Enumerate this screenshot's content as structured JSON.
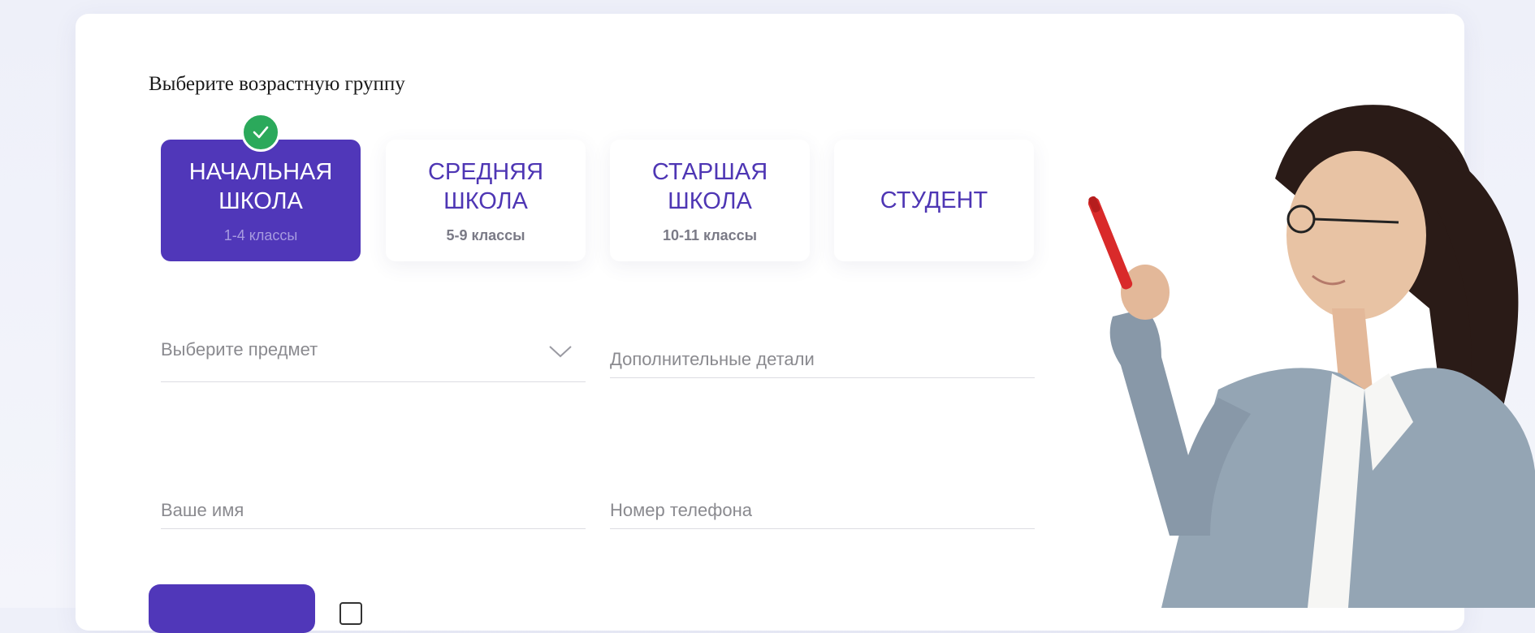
{
  "form": {
    "heading": "Выберите возрастную группу",
    "age_groups": [
      {
        "title": "НАЧАЛЬНАЯ ШКОЛА",
        "subtitle": "1-4 классы",
        "selected": true
      },
      {
        "title": "СРЕДНЯЯ ШКОЛА",
        "subtitle": "5-9 классы",
        "selected": false
      },
      {
        "title": "СТАРШАЯ ШКОЛА",
        "subtitle": "10-11 классы",
        "selected": false
      },
      {
        "title": "СТУДЕНТ",
        "subtitle": "",
        "selected": false
      }
    ],
    "subject_select": {
      "placeholder": "Выберите предмет",
      "icon": "chevron-down-icon"
    },
    "details_input": {
      "value": "",
      "placeholder": "Дополнительные детали"
    },
    "name_input": {
      "value": "",
      "placeholder": "Ваше имя"
    },
    "phone_input": {
      "value": "",
      "placeholder": "Номер телефона"
    },
    "check_icon": "check-icon"
  },
  "colors": {
    "accent": "#5037b9",
    "accent_text": "#4e36b4",
    "check": "#2ba95b",
    "page_bg": "#eef0f9",
    "card_bg": "#ffffff"
  },
  "illustration": {
    "icon": "woman-with-marker-illustration"
  }
}
